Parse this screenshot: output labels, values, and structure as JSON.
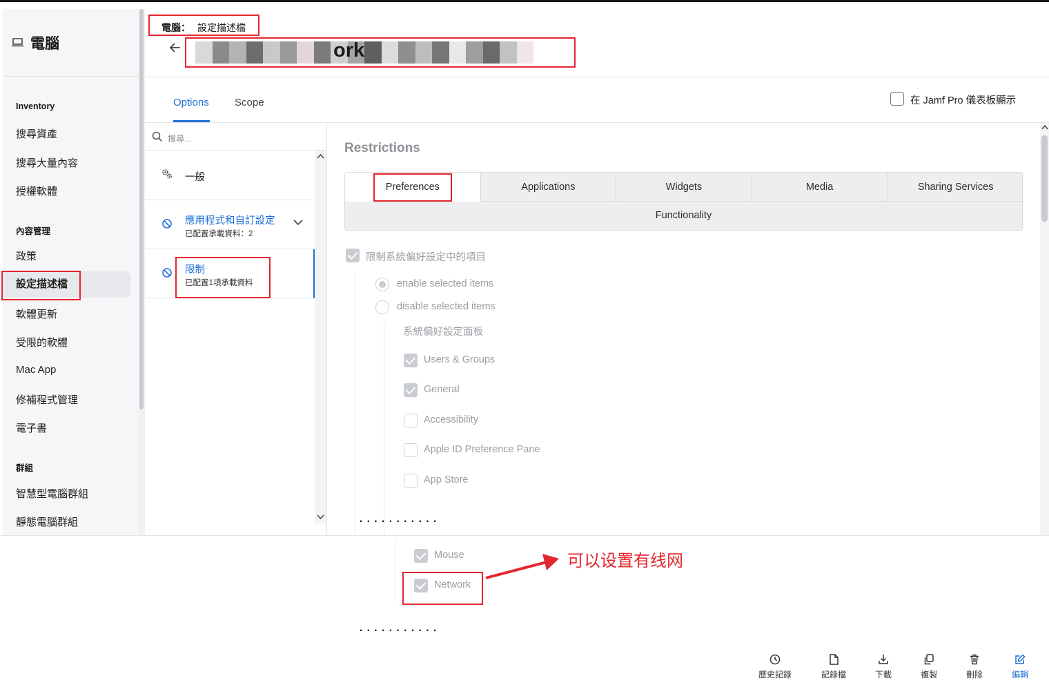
{
  "sidebar": {
    "title": "電腦",
    "sections": [
      {
        "label": "Inventory",
        "items": [
          "搜尋資產",
          "搜尋大量內容",
          "授權軟體"
        ]
      },
      {
        "label": "內容管理",
        "items": [
          "政策",
          "設定描述檔",
          "軟體更新",
          "受限的軟體",
          "Mac App",
          "修補程式管理",
          "電子書"
        ]
      },
      {
        "label": "群組",
        "items": [
          "智慧型電腦群組",
          "靜態電腦群組"
        ]
      }
    ],
    "active_item": "設定描述檔"
  },
  "header": {
    "breadcrumb_root": "電腦：",
    "breadcrumb_page": "設定描述檔",
    "back_icon": "arrow-left-icon",
    "title_visible_suffix": "ork"
  },
  "tabs": [
    {
      "label": "Options",
      "active": true
    },
    {
      "label": "Scope",
      "active": false
    }
  ],
  "dashboard_toggle": {
    "label": "在 Jamf Pro 儀表板顯示",
    "checked": false
  },
  "payloads": {
    "search_placeholder": "搜尋...",
    "items": [
      {
        "label": "一般",
        "subtitle": "",
        "icon": "gears-icon"
      },
      {
        "label": "應用程式和自訂設定",
        "subtitle": "已配置承載資料：2",
        "icon": "restricted-icon"
      },
      {
        "label": "限制",
        "subtitle": "已配置1項承載資料",
        "icon": "restricted-icon",
        "selected": true
      }
    ]
  },
  "restrictions": {
    "title": "Restrictions",
    "seg_tabs": [
      "Preferences",
      "Applications",
      "Widgets",
      "Media",
      "Sharing Services"
    ],
    "seg_tab_row2": "Functionality",
    "active_seg": "Preferences",
    "restrict_label": "限制系統偏好設定中的項目",
    "restrict_checked": true,
    "radio_enable": "enable selected items",
    "radio_disable": "disable selected items",
    "pane_heading": "系統偏好設定面板",
    "panes": [
      {
        "label": "Users & Groups",
        "checked": true
      },
      {
        "label": "General",
        "checked": true
      },
      {
        "label": "Accessibility",
        "checked": false
      },
      {
        "label": "Apple ID Preference Pane",
        "checked": false
      },
      {
        "label": "App Store",
        "checked": false
      }
    ],
    "extra_panes": [
      {
        "label": "Mouse",
        "checked": true
      },
      {
        "label": "Network",
        "checked": true
      }
    ]
  },
  "annotation": {
    "text": "可以设置有线网",
    "color": "#e3262f"
  },
  "ellipsis": "...........",
  "toolbar": [
    {
      "label": "歷史記錄",
      "icon": "clock-icon"
    },
    {
      "label": "記錄檔",
      "icon": "file-icon"
    },
    {
      "label": "下載",
      "icon": "download-icon"
    },
    {
      "label": "複製",
      "icon": "copy-icon"
    },
    {
      "label": "刪除",
      "icon": "trash-icon"
    },
    {
      "label": "編輯",
      "icon": "edit-icon",
      "accent": "#1d6fd6"
    }
  ],
  "colors": {
    "accent": "#1d6fd6",
    "annotation_red": "#e3262f",
    "disabled_text": "#9a9ea3"
  }
}
